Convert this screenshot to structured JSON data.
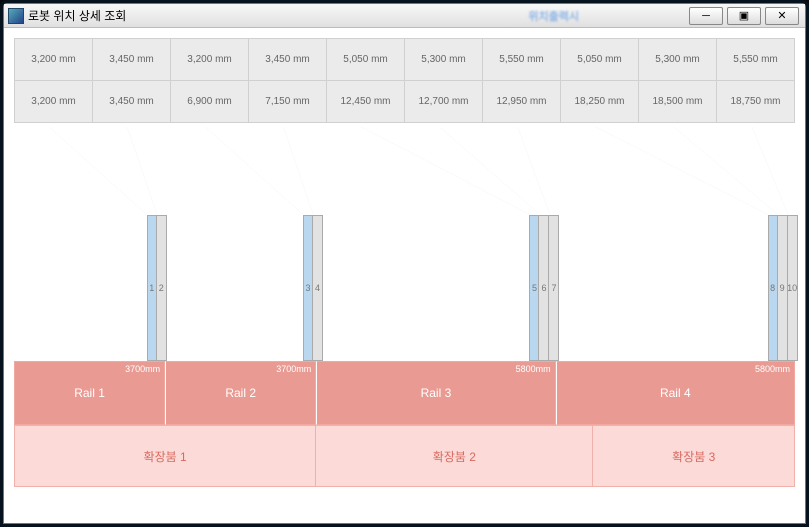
{
  "window": {
    "title": "로봇 위치 상세 조회",
    "blur_label": "위치출력시",
    "btn_min": "─",
    "btn_max": "▣",
    "btn_close": "✕"
  },
  "table": {
    "row1": [
      "3,200 mm",
      "3,450 mm",
      "3,200 mm",
      "3,450 mm",
      "5,050 mm",
      "5,300 mm",
      "5,550 mm",
      "5,050 mm",
      "5,300 mm",
      "5,550 mm"
    ],
    "row2": [
      "3,200 mm",
      "3,450 mm",
      "6,900 mm",
      "7,150 mm",
      "12,450 mm",
      "12,700 mm",
      "12,950 mm",
      "18,250 mm",
      "18,500 mm",
      "18,750 mm"
    ]
  },
  "rails": [
    {
      "name": "Rail 1",
      "len": "3700mm"
    },
    {
      "name": "Rail 2",
      "len": "3700mm"
    },
    {
      "name": "Rail 3",
      "len": "5800mm"
    },
    {
      "name": "Rail 4",
      "len": "5800mm"
    }
  ],
  "extensions": [
    "확장붐 1",
    "확장붐 2",
    "확장붐 3"
  ],
  "sensor_groups": [
    {
      "left_pct": 17.0,
      "sensors": [
        {
          "label": "1",
          "cls": "blue"
        },
        {
          "label": "2",
          "cls": "grey"
        }
      ]
    },
    {
      "left_pct": 37.0,
      "sensors": [
        {
          "label": "3",
          "cls": "blue"
        },
        {
          "label": "4",
          "cls": "grey"
        }
      ]
    },
    {
      "left_pct": 66.0,
      "sensors": [
        {
          "label": "5",
          "cls": "blue"
        },
        {
          "label": "6",
          "cls": "grey"
        },
        {
          "label": "7",
          "cls": "grey"
        }
      ]
    },
    {
      "left_pct": 96.5,
      "sensors": [
        {
          "label": "8",
          "cls": "blue"
        },
        {
          "label": "9",
          "cls": "grey"
        },
        {
          "label": "10",
          "cls": "grey"
        }
      ]
    }
  ],
  "lines": [
    [
      4.5,
      0,
      17.0
    ],
    [
      14.5,
      0,
      18.3
    ],
    [
      24.5,
      0,
      37.0
    ],
    [
      34.5,
      0,
      38.3
    ],
    [
      44.5,
      0,
      66.0
    ],
    [
      54.5,
      0,
      67.3
    ],
    [
      64.5,
      0,
      68.6
    ],
    [
      74.5,
      0,
      96.5
    ],
    [
      84.5,
      0,
      97.8
    ],
    [
      94.5,
      0,
      99.1
    ]
  ],
  "chart_data": {
    "type": "table",
    "title": "로봇 위치 상세 조회",
    "columns": [
      1,
      2,
      3,
      4,
      5,
      6,
      7,
      8,
      9,
      10
    ],
    "rows": [
      {
        "name": "row1_mm",
        "values": [
          3200,
          3450,
          3200,
          3450,
          5050,
          5300,
          5550,
          5050,
          5300,
          5550
        ]
      },
      {
        "name": "row2_mm_cumulative",
        "values": [
          3200,
          3450,
          6900,
          7150,
          12450,
          12700,
          12950,
          18250,
          18500,
          18750
        ]
      }
    ],
    "rails": [
      {
        "name": "Rail 1",
        "length_mm": 3700
      },
      {
        "name": "Rail 2",
        "length_mm": 3700
      },
      {
        "name": "Rail 3",
        "length_mm": 5800
      },
      {
        "name": "Rail 4",
        "length_mm": 5800
      }
    ],
    "extension_booms": [
      "확장붐 1",
      "확장붐 2",
      "확장붐 3"
    ],
    "sensor_labels": [
      1,
      2,
      3,
      4,
      5,
      6,
      7,
      8,
      9,
      10
    ]
  }
}
